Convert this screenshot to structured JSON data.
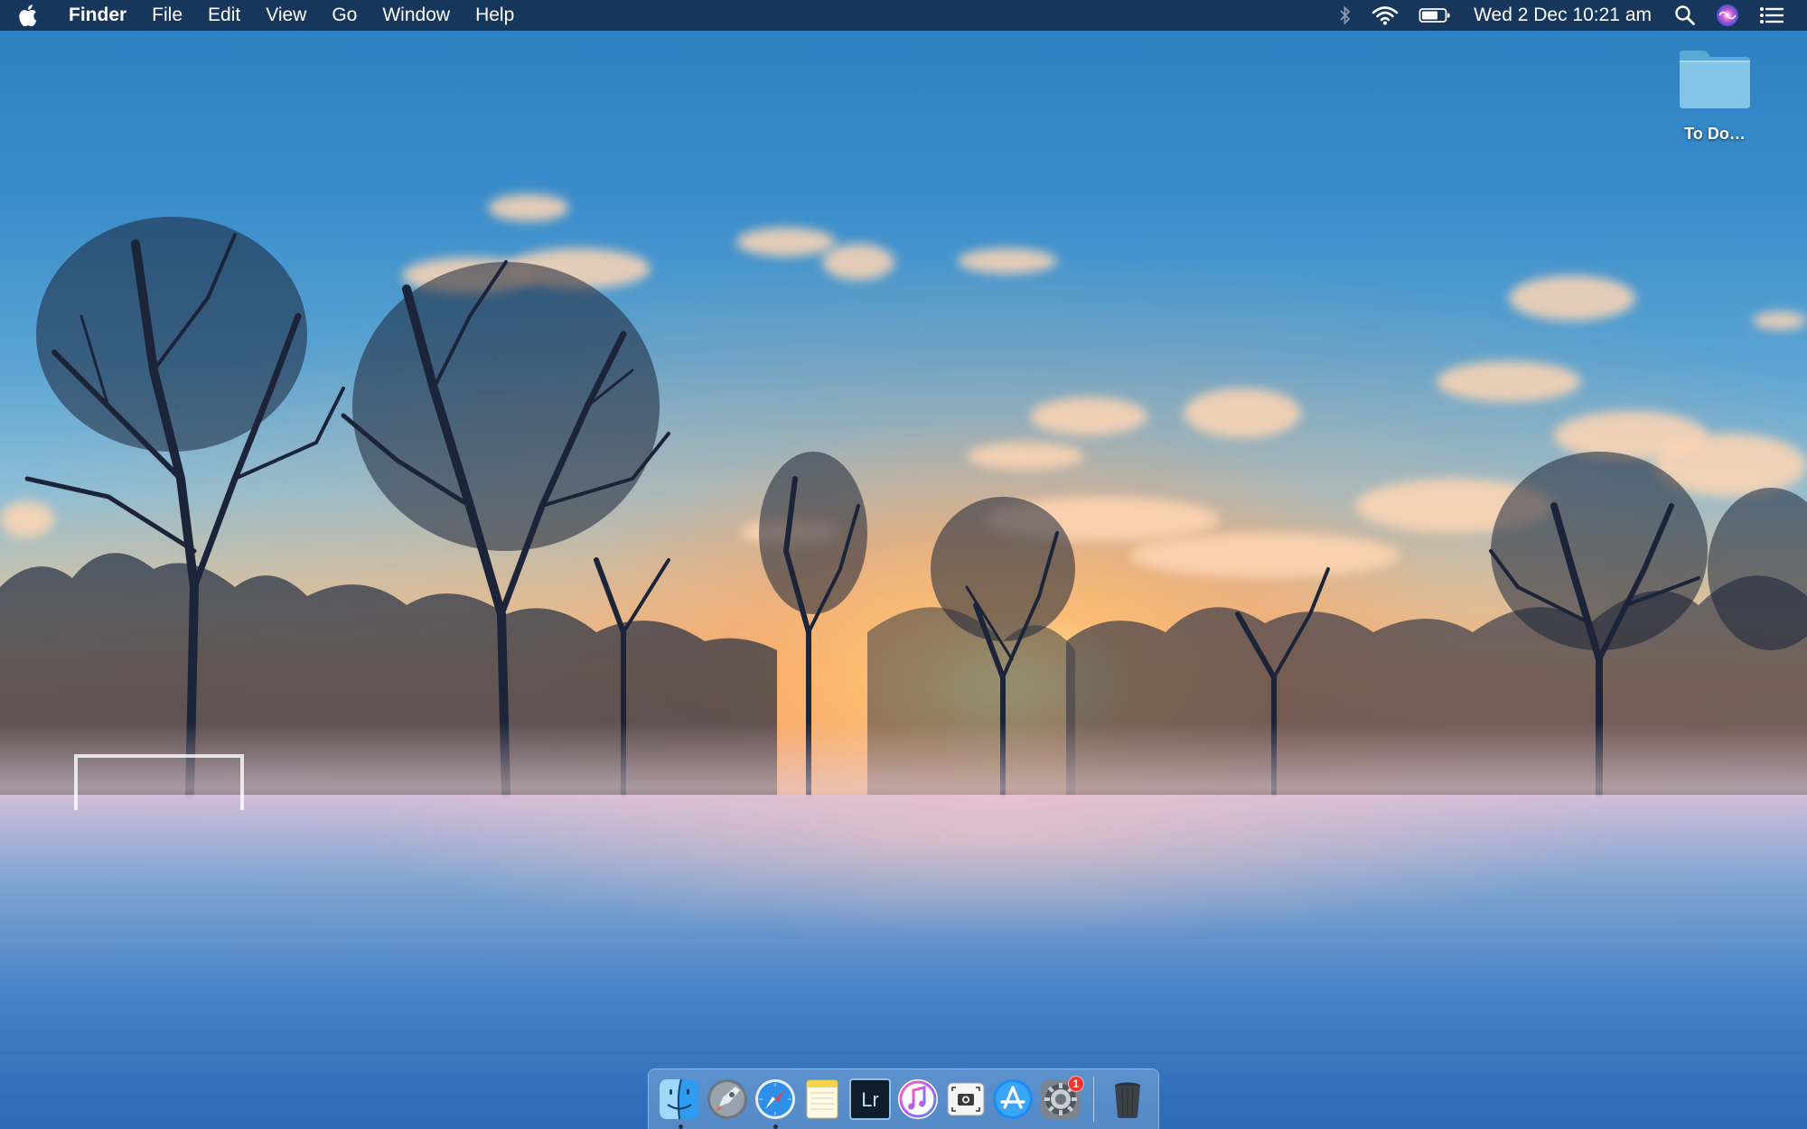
{
  "menubar": {
    "app_name": "Finder",
    "menus": [
      "File",
      "Edit",
      "View",
      "Go",
      "Window",
      "Help"
    ],
    "clock": "Wed 2 Dec  10:21 am",
    "status_icons": [
      "bluetooth-icon",
      "wifi-icon",
      "battery-icon",
      "spotlight-search-icon",
      "siri-icon",
      "notification-center-icon"
    ]
  },
  "desktop": {
    "icons": [
      {
        "label": "To Do…",
        "icon": "folder-icon"
      }
    ]
  },
  "dock": {
    "apps": [
      {
        "name": "Finder",
        "icon": "finder-icon",
        "running": true
      },
      {
        "name": "Launchpad",
        "icon": "launchpad-icon",
        "running": false
      },
      {
        "name": "Safari",
        "icon": "safari-icon",
        "running": true
      },
      {
        "name": "Notes",
        "icon": "notes-icon",
        "running": false
      },
      {
        "name": "Lightroom",
        "icon": "lightroom-icon",
        "label": "Lr",
        "running": false
      },
      {
        "name": "iTunes",
        "icon": "itunes-icon",
        "running": false
      },
      {
        "name": "Screenshot",
        "icon": "screenshot-icon",
        "running": false
      },
      {
        "name": "App Store",
        "icon": "app-store-icon",
        "running": false
      },
      {
        "name": "System Preferences",
        "icon": "system-preferences-icon",
        "badge": "1",
        "running": false
      },
      {
        "name": "Trash",
        "icon": "trash-icon",
        "running": false
      }
    ]
  },
  "colors": {
    "menubar_bg": "#163054",
    "badge": "#f0382e",
    "folder": "#7fbfe0"
  }
}
